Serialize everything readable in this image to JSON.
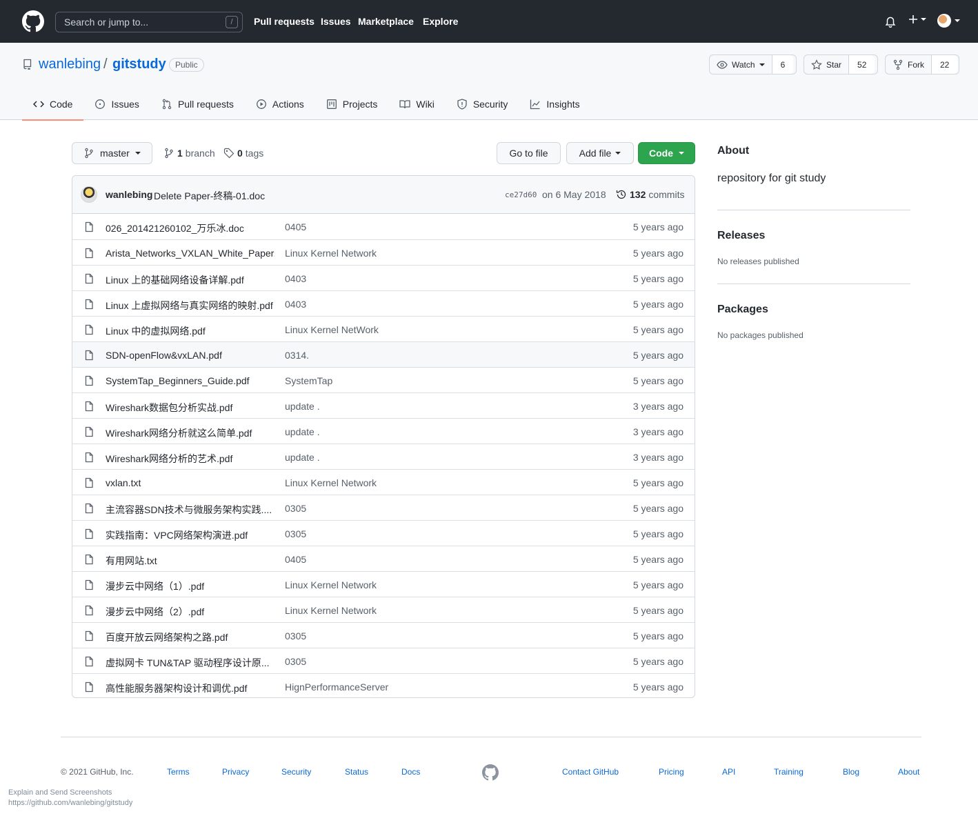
{
  "header": {
    "search_placeholder": "Search or jump to...",
    "search_shortcut": "/",
    "nav": [
      "Pull requests",
      "Issues",
      "Marketplace",
      "Explore"
    ]
  },
  "repo": {
    "owner": "wanlebing",
    "separator": "/",
    "name": "gitstudy",
    "visibility": "Public",
    "watch_label": "Watch",
    "watch_count": "6",
    "star_label": "Star",
    "star_count": "52",
    "fork_label": "Fork",
    "fork_count": "22"
  },
  "tabs": [
    {
      "label": "Code",
      "icon": "code-icon",
      "active": true
    },
    {
      "label": "Issues",
      "icon": "issue-opened-icon"
    },
    {
      "label": "Pull requests",
      "icon": "git-pull-request-icon"
    },
    {
      "label": "Actions",
      "icon": "play-icon"
    },
    {
      "label": "Projects",
      "icon": "project-icon"
    },
    {
      "label": "Wiki",
      "icon": "book-icon"
    },
    {
      "label": "Security",
      "icon": "shield-icon"
    },
    {
      "label": "Insights",
      "icon": "graph-icon"
    }
  ],
  "filenav": {
    "branch": "master",
    "branch_count": "1",
    "branch_word": "branch",
    "tag_count": "0",
    "tag_word": "tags",
    "go_to_file": "Go to file",
    "add_file": "Add file",
    "code": "Code"
  },
  "commit": {
    "author": "wanlebing",
    "message": "Delete Paper-终稿-01.doc",
    "sha": "ce27d60",
    "date": "on 6 May 2018",
    "count": "132",
    "count_word": "commits"
  },
  "files": [
    {
      "name": "026_201421260102_万乐冰.doc",
      "message": "0405",
      "age": "5 years ago"
    },
    {
      "name": "Arista_Networks_VXLAN_White_Paper...",
      "message": "Linux Kernel Network",
      "age": "5 years ago"
    },
    {
      "name": "Linux 上的基础网络设备详解.pdf",
      "message": "0403",
      "age": "5 years ago"
    },
    {
      "name": "Linux 上虚拟网络与真实网络的映射.pdf",
      "message": "0403",
      "age": "5 years ago"
    },
    {
      "name": "Linux 中的虚拟网络.pdf",
      "message": "Linux Kernel NetWork",
      "age": "5 years ago"
    },
    {
      "name": "SDN-openFlow&vxLAN.pdf",
      "message": "0314.",
      "age": "5 years ago"
    },
    {
      "name": "SystemTap_Beginners_Guide.pdf",
      "message": "SystemTap",
      "age": "5 years ago"
    },
    {
      "name": "Wireshark数据包分析实战.pdf",
      "message": "update .",
      "age": "3 years ago"
    },
    {
      "name": "Wireshark网络分析就这么简单.pdf",
      "message": "update .",
      "age": "3 years ago"
    },
    {
      "name": "Wireshark网络分析的艺术.pdf",
      "message": "update .",
      "age": "3 years ago"
    },
    {
      "name": "vxlan.txt",
      "message": "Linux Kernel Network",
      "age": "5 years ago"
    },
    {
      "name": "主流容器SDN技术与微服务架构实践....",
      "message": "0305",
      "age": "5 years ago"
    },
    {
      "name": "实践指南：VPC网络架构演进.pdf",
      "message": "0305",
      "age": "5 years ago"
    },
    {
      "name": "有用网站.txt",
      "message": "0405",
      "age": "5 years ago"
    },
    {
      "name": "漫步云中网络（1）.pdf",
      "message": "Linux Kernel Network",
      "age": "5 years ago"
    },
    {
      "name": "漫步云中网络（2）.pdf",
      "message": "Linux Kernel Network",
      "age": "5 years ago"
    },
    {
      "name": "百度开放云网络架构之路.pdf",
      "message": "0305",
      "age": "5 years ago"
    },
    {
      "name": "虚拟网卡 TUN&TAP 驱动程序设计原...",
      "message": "0305",
      "age": "5 years ago"
    },
    {
      "name": "高性能服务器架构设计和调优.pdf",
      "message": "HignPerformanceServer",
      "age": "5 years ago"
    }
  ],
  "sidebar": {
    "about_title": "About",
    "about_desc": "repository for git study",
    "releases_title": "Releases",
    "releases_text": "No releases published",
    "packages_title": "Packages",
    "packages_text": "No packages published"
  },
  "footer": {
    "copyright": "© 2021 GitHub, Inc.",
    "left_links": [
      "Terms",
      "Privacy",
      "Security",
      "Status",
      "Docs"
    ],
    "right_links": [
      "Contact GitHub",
      "Pricing",
      "API",
      "Training",
      "Blog",
      "About"
    ]
  },
  "overlay": {
    "line1": "Explain and Send Screenshots",
    "line2": "https://github.com/wanlebing/gitstudy"
  },
  "colors": {
    "header_bg": "#24292f",
    "link": "#0969da",
    "code_button": "#2da44e",
    "active_tab_underline": "#fd8c73"
  }
}
